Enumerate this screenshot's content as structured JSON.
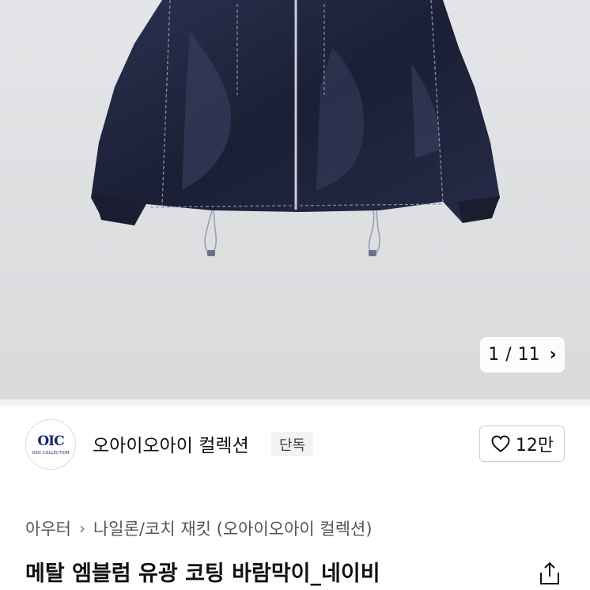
{
  "image_viewer": {
    "current_page": "1",
    "total_pages": "11",
    "separator": "/",
    "next_icon": "chevron-right-icon",
    "background": "#dedfe1"
  },
  "store": {
    "logo_text": "OIC",
    "logo_subtext": "OIOI COLLECTION",
    "name": "오아이오아이 컬렉션",
    "badge": "단독",
    "like_count": "12만",
    "like_icon": "heart-outline-icon"
  },
  "breadcrumb": {
    "items": [
      "아우터",
      "나일론/코치 재킷 (오아이오아이 컬렉션)"
    ],
    "separator_icon": "chevron-right-icon"
  },
  "product": {
    "title": "메탈 엠블럼 유광 코팅 바람막이_네이비",
    "share_icon": "share-icon"
  },
  "colors": {
    "jacket": "#1e2238",
    "brand_navy": "#1a2a6c"
  }
}
